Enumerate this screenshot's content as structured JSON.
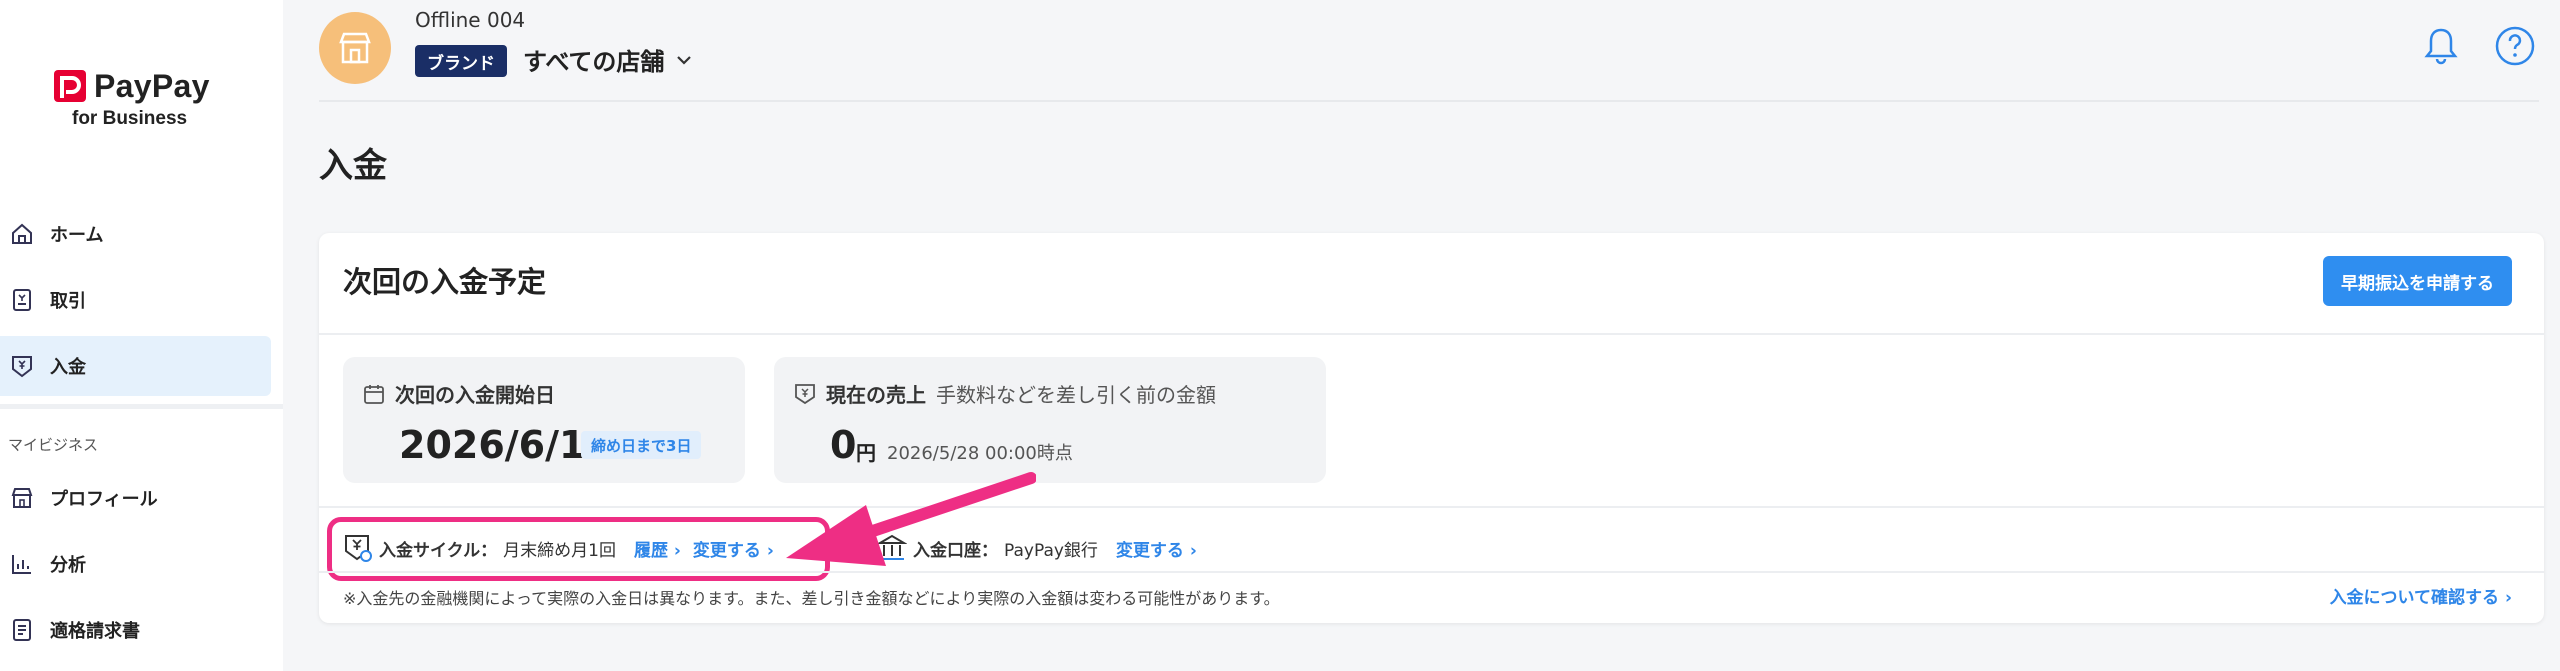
{
  "brand": {
    "name": "PayPay",
    "sub": "for Business",
    "color": "#e60033"
  },
  "sidebar": {
    "items": [
      {
        "label": "ホーム",
        "icon": "home-icon"
      },
      {
        "label": "取引",
        "icon": "receipt-icon"
      },
      {
        "label": "入金",
        "icon": "deposit-icon",
        "active": true
      }
    ],
    "section_label": "マイビジネス",
    "section_items": [
      {
        "label": "プロフィール",
        "icon": "store-icon"
      },
      {
        "label": "分析",
        "icon": "chart-icon"
      },
      {
        "label": "適格請求書",
        "icon": "invoice-icon"
      }
    ]
  },
  "header": {
    "store_name": "Offline 004",
    "brand_badge": "ブランド",
    "store_select": "すべての店舗"
  },
  "page": {
    "title": "入金"
  },
  "card": {
    "title": "次回の入金予定",
    "early_button": "早期振込を申請する",
    "next_date_label": "次回の入金開始日",
    "next_date": "2026/6/1",
    "deadline_badge": "締め日まで3日",
    "sales_label": "現在の売上",
    "sales_sub": "手数料などを差し引く前の金額",
    "sales_amount": "0",
    "sales_unit": "円",
    "sales_time": "2026/5/28 00:00時点",
    "cycle_label": "入金サイクル：",
    "cycle_value": "月末締め月1回",
    "history_link": "履歴",
    "change_link": "変更する",
    "bank_label": "入金口座：",
    "bank_value": "PayPay銀行",
    "bank_change_link": "変更する",
    "note": "※入金先の金融機関によって実際の入金日は異なります。また、差し引き金額などにより実際の入金額は変わる可能性があります。",
    "about_link": "入金について確認する"
  },
  "colors": {
    "accent": "#2f8ef0",
    "highlight": "#ee2e84",
    "badge_navy": "#1a2e66"
  }
}
